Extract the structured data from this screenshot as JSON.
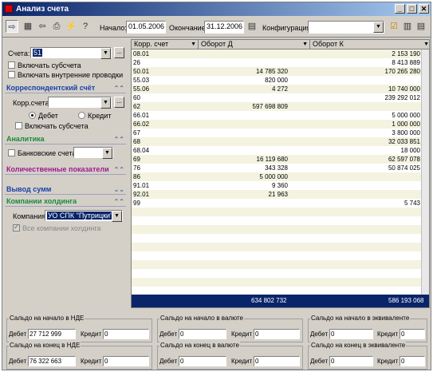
{
  "window": {
    "title": "Анализ счета"
  },
  "toolbar": {
    "start_label": "Начало:",
    "start_value": "01.05.2006",
    "end_label": "Окончание:",
    "end_value": "31.12.2006",
    "config_label": "Конфигурация:",
    "config_value": ""
  },
  "left": {
    "account_label": "Счета:",
    "account_value": "51",
    "include_subaccounts": "Включать субсчета",
    "include_internal": "Включать внутренние проводки",
    "corr_section": "Корреспондентский счёт",
    "corr_label": "Корр.счета:",
    "corr_value": "",
    "debit": "Дебет",
    "credit": "Кредит",
    "corr_include_sub": "Включать субсчета",
    "analytics_section": "Аналитика",
    "bank_accounts": "Банковские счета:",
    "qty_section": "Количественные показатели",
    "output_section": "Вывод сумм",
    "holding_section": "Компании холдинга",
    "company_label": "Компания:",
    "company_value": "УО СПК \"Путрицки\"",
    "all_companies": "Все компании холдинга"
  },
  "grid": {
    "headers": [
      "Корр. счет",
      "Оборот Д",
      "Оборот К"
    ],
    "rows": [
      [
        "08.01",
        "",
        "2 153 190"
      ],
      [
        "26",
        "",
        "8 413 889"
      ],
      [
        "50.01",
        "14 785 320",
        "170 265 280"
      ],
      [
        "55.03",
        "820 000",
        ""
      ],
      [
        "55.06",
        "4 272",
        "10 740 000"
      ],
      [
        "60",
        "",
        "239 292 012"
      ],
      [
        "62",
        "597 698 809",
        ""
      ],
      [
        "66.01",
        "",
        "5 000 000"
      ],
      [
        "66.02",
        "",
        "1 000 000"
      ],
      [
        "67",
        "",
        "3 800 000"
      ],
      [
        "68",
        "",
        "32 033 851"
      ],
      [
        "68.04",
        "",
        "18 000"
      ],
      [
        "69",
        "16 119 680",
        "62 597 078"
      ],
      [
        "76",
        "343 328",
        "50 874 025"
      ],
      [
        "86",
        "5 000 000",
        ""
      ],
      [
        "91.01",
        "9 360",
        ""
      ],
      [
        "92.01",
        "21 963",
        ""
      ],
      [
        "99",
        "",
        "5 743"
      ]
    ],
    "total_debit": "634 802 732",
    "total_credit": "586 193 068"
  },
  "bottom": {
    "g1_title": "Сальдо на начало в НДЕ",
    "g1_debit": "27 712 999",
    "g1_credit": "0",
    "g2_title": "Сальдо на начало в валюте",
    "g2_debit": "0",
    "g2_credit": "0",
    "g3_title": "Сальдо на начало в эквиваленте",
    "g3_debit": "0",
    "g3_credit": "0",
    "g4_title": "Сальдо на  конец в НДЕ",
    "g4_debit": "76 322 663",
    "g4_credit": "0",
    "g5_title": "Сальдо на  конец в валюте",
    "g5_debit": "0",
    "g5_credit": "0",
    "g6_title": "Сальдо на  конец в эквиваленте",
    "g6_debit": "0",
    "g6_credit": "0",
    "debit_label": "Дебет",
    "credit_label": "Кредит"
  }
}
